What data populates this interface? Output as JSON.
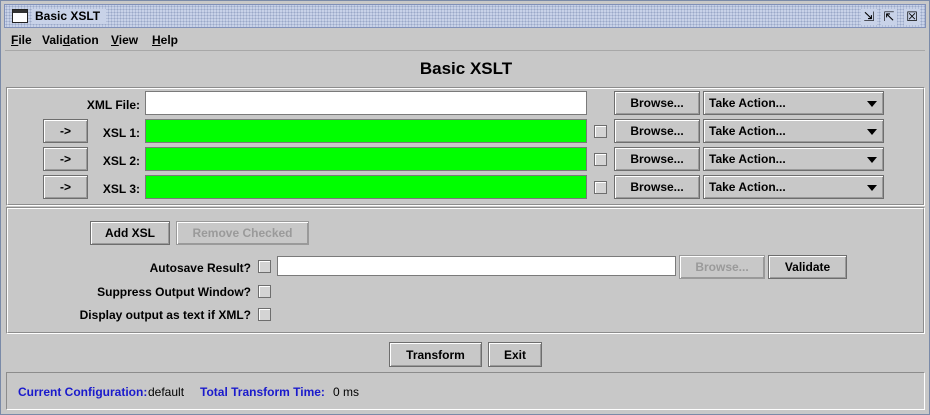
{
  "window": {
    "title": "Basic XSLT",
    "controls": {
      "minimize": "⇲",
      "maximize": "⇱",
      "close": "☒"
    }
  },
  "menu": [
    {
      "label": "File",
      "mnemonic": "F",
      "rest": "ile"
    },
    {
      "label": "Validation",
      "pre": "Vali",
      "mnemonic": "d",
      "rest": "ation"
    },
    {
      "label": "View",
      "mnemonic": "V",
      "rest": "iew"
    },
    {
      "label": "Help",
      "mnemonic": "H",
      "rest": "elp"
    }
  ],
  "heading": "Basic XSLT",
  "xml_row": {
    "label": "XML File:",
    "value": "",
    "browse_label": "Browse...",
    "action_label": "Take Action..."
  },
  "xsl_rows": [
    {
      "arrow_label": "->",
      "label": "XSL 1:",
      "value": "",
      "checked": false,
      "browse_label": "Browse...",
      "action_label": "Take Action..."
    },
    {
      "arrow_label": "->",
      "label": "XSL 2:",
      "value": "",
      "checked": false,
      "browse_label": "Browse...",
      "action_label": "Take Action..."
    },
    {
      "arrow_label": "->",
      "label": "XSL 3:",
      "value": "",
      "checked": false,
      "browse_label": "Browse...",
      "action_label": "Take Action..."
    }
  ],
  "options": {
    "add_xsl_label": "Add XSL",
    "remove_checked_label": "Remove Checked",
    "autosave_label": "Autosave Result?",
    "autosave_value": "",
    "autosave_browse_label": "Browse...",
    "validate_label": "Validate",
    "suppress_label": "Suppress Output Window?",
    "display_text_label": "Display output as text if XML?"
  },
  "actions": {
    "transform_label": "Transform",
    "exit_label": "Exit"
  },
  "status": {
    "config_label": "Current Configuration:",
    "config_value": "default",
    "time_label": "Total Transform Time:",
    "time_value": "0 ms"
  },
  "colors": {
    "xsl_field_bg": "#00ff00",
    "status_label": "#1a1acc",
    "window_bg": "#c8c8c8"
  }
}
